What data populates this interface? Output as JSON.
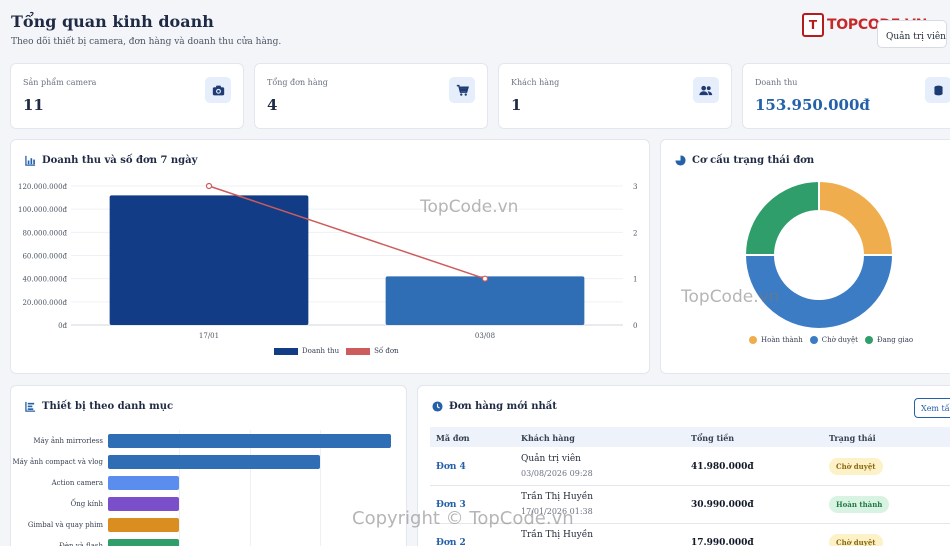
{
  "header": {
    "title": "Tổng quan kinh doanh",
    "subtitle": "Theo dõi thiết bị camera, đơn hàng và doanh thu cửa hàng.",
    "logo_mark": "T",
    "logo_text": "TOPCODE.VN",
    "user_label": "Quản trị viên"
  },
  "kpis": [
    {
      "label": "Sản phẩm camera",
      "value": "11",
      "icon": "camera-icon"
    },
    {
      "label": "Tổng đơn hàng",
      "value": "4",
      "icon": "cart-icon"
    },
    {
      "label": "Khách hàng",
      "value": "1",
      "icon": "users-icon"
    },
    {
      "label": "Doanh thu",
      "value": "153.950.000đ",
      "icon": "money-icon"
    }
  ],
  "revenue_chart": {
    "title": "Doanh thu và số đơn 7 ngày",
    "legend": [
      "Doanh thu",
      "Số đơn"
    ]
  },
  "status_chart": {
    "title": "Cơ cấu trạng thái đơn",
    "legend": [
      "Hoàn thành",
      "Chờ duyệt",
      "Đang giao"
    ]
  },
  "category_chart": {
    "title": "Thiết bị theo danh mục"
  },
  "orders": {
    "title": "Đơn hàng mới nhất",
    "see_all": "Xem tất",
    "columns": [
      "Mã đơn",
      "Khách hàng",
      "Tổng tiền",
      "Trạng thái"
    ],
    "rows": [
      {
        "id": "Đơn 4",
        "customer": "Quản trị viên",
        "date": "03/08/2026 09:28",
        "total": "41.980.000đ",
        "status": "Chờ duyệt"
      },
      {
        "id": "Đơn 3",
        "customer": "Trần Thị Huyền",
        "date": "17/01/2026 01:38",
        "total": "30.990.000đ",
        "status": "Hoàn thành"
      },
      {
        "id": "Đơn 2",
        "customer": "Trần Thị Huyền",
        "date": "",
        "total": "17.990.000đ",
        "status": "Chờ duyệt"
      }
    ]
  },
  "watermarks": [
    "TopCode.vn",
    "TopCode.vn",
    "Copyright © TopCode.vn"
  ],
  "colors": {
    "navy": "#133c86",
    "blue": "#2f6db5",
    "line": "#cd5c5c",
    "orange": "#f0ad4e",
    "green": "#2f9e6a"
  },
  "chart_data": [
    {
      "type": "bar",
      "categories": [
        "17/01",
        "03/08"
      ],
      "series": [
        {
          "name": "Doanh thu",
          "values": [
            111940000,
            41980000
          ],
          "axis": "left"
        },
        {
          "name": "Số đơn",
          "values": [
            3,
            1
          ],
          "axis": "right",
          "render": "line"
        }
      ],
      "yticks_left": [
        "0đ",
        "20.000.000đ",
        "40.000.000đ",
        "60.000.000đ",
        "80.000.000đ",
        "100.000.000đ",
        "120.000.000đ"
      ],
      "yticks_right": [
        "0",
        "1",
        "2",
        "3"
      ],
      "ylim": [
        0,
        120000000
      ],
      "ylim_right": [
        0,
        3
      ]
    },
    {
      "type": "pie",
      "categories": [
        "Hoàn thành",
        "Chờ duyệt",
        "Đang giao"
      ],
      "values": [
        1,
        2,
        1
      ]
    },
    {
      "type": "bar",
      "orientation": "horizontal",
      "categories": [
        "Máy ảnh mirrorless",
        "Máy ảnh compact và vlog",
        "Action camera",
        "Ống kính",
        "Gimbal và quay phim",
        "Đèn và flash"
      ],
      "values": [
        4,
        3,
        1,
        1,
        1,
        1
      ],
      "colors": [
        "#2f6db5",
        "#2f6db5",
        "#5b8def",
        "#7b4fc9",
        "#d98e1f",
        "#2f9e6a"
      ]
    }
  ]
}
